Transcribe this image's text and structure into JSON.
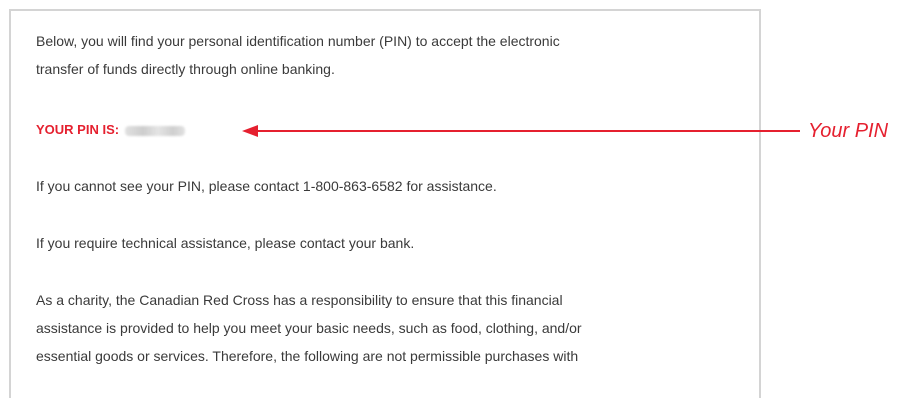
{
  "email": {
    "intro": [
      "Below, you will find your personal identification number (PIN) to accept the electronic",
      "transfer of funds directly through online banking."
    ],
    "pin_label": "YOUR PIN IS:",
    "cannot_see": "If you cannot see your PIN, please contact 1-800-863-6582 for assistance.",
    "technical": "If you require technical assistance, please contact your bank.",
    "charity": [
      "As a charity, the Canadian Red Cross has a responsibility to ensure that this financial",
      "assistance is provided to help you meet your basic needs, such as food, clothing, and/or",
      "essential goods or services. Therefore, the following are not permissible purchases with"
    ]
  },
  "annotation": {
    "label": "Your PIN",
    "color": "#e5202f"
  },
  "colors": {
    "body_text": "#3a3a3a",
    "pin_label": "#e5202f",
    "card_border": "#d4d4d4"
  }
}
